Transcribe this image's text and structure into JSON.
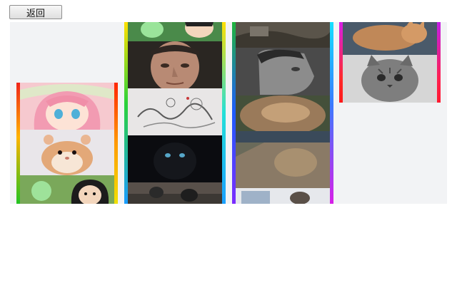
{
  "back_button": {
    "label": "返回"
  },
  "gallery": {
    "columns": [
      {
        "tiles": [
          {
            "icon": "anime-girl-image"
          },
          {
            "icon": "hamster-image"
          },
          {
            "icon": "cartoon-friends-image"
          }
        ]
      },
      {
        "tiles": [
          {
            "icon": "cartoon-characters-image"
          },
          {
            "icon": "man-portrait-image"
          },
          {
            "icon": "pencil-sketch-image"
          },
          {
            "icon": "black-cat-eyes-image"
          },
          {
            "icon": "cats-bedroom-image"
          }
        ]
      },
      {
        "tiles": [
          {
            "icon": "vintage-photo-image"
          },
          {
            "icon": "man-profile-portrait-image"
          },
          {
            "icon": "sleeping-cat-image"
          },
          {
            "icon": "cat-closeup-image"
          },
          {
            "icon": "cat-window-image"
          }
        ]
      },
      {
        "tiles": [
          {
            "icon": "orange-cat-image"
          },
          {
            "icon": "tabby-kitten-image"
          }
        ]
      }
    ]
  }
}
